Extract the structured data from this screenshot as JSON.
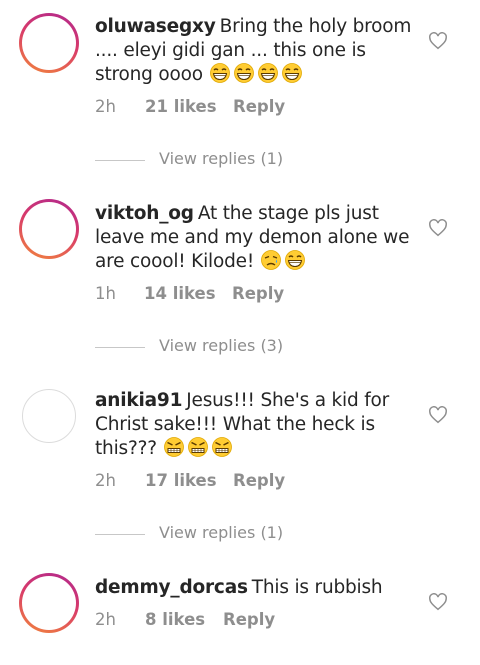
{
  "comments": [
    {
      "username": "oluwasegxy",
      "text": "Bring the holy broom .... eleyi gidi gan ... this one is strong oooo",
      "emojis": [
        "grin",
        "grin",
        "grin",
        "grin"
      ],
      "time": "2h",
      "likes": "21 likes",
      "reply": "Reply",
      "avatar_style": "ring",
      "view_replies": "View replies (1)"
    },
    {
      "username": "viktoh_og",
      "text": "At the stage pls just leave me and my demon alone we are coool! Kilode!",
      "emojis": [
        "sad",
        "grin"
      ],
      "time": "1h",
      "likes": "14 likes",
      "reply": "Reply",
      "avatar_style": "ring",
      "view_replies": "View replies (3)"
    },
    {
      "username": "anikia91",
      "text": "Jesus!!! She's a kid for Christ sake!!! What the heck is this???",
      "emojis": [
        "angry",
        "angry",
        "angry"
      ],
      "time": "2h",
      "likes": "17 likes",
      "reply": "Reply",
      "avatar_style": "plain",
      "view_replies": "View replies (1)"
    },
    {
      "username": "demmy_dorcas",
      "text": "This is rubbish",
      "emojis": [],
      "time": "2h",
      "likes": "8 likes",
      "reply": "Reply",
      "avatar_style": "ring",
      "view_replies": ""
    }
  ],
  "colors": {
    "ring_start": "#b0288f",
    "ring_end": "#f2863c",
    "text": "#262626",
    "muted": "#8e8e8e"
  }
}
